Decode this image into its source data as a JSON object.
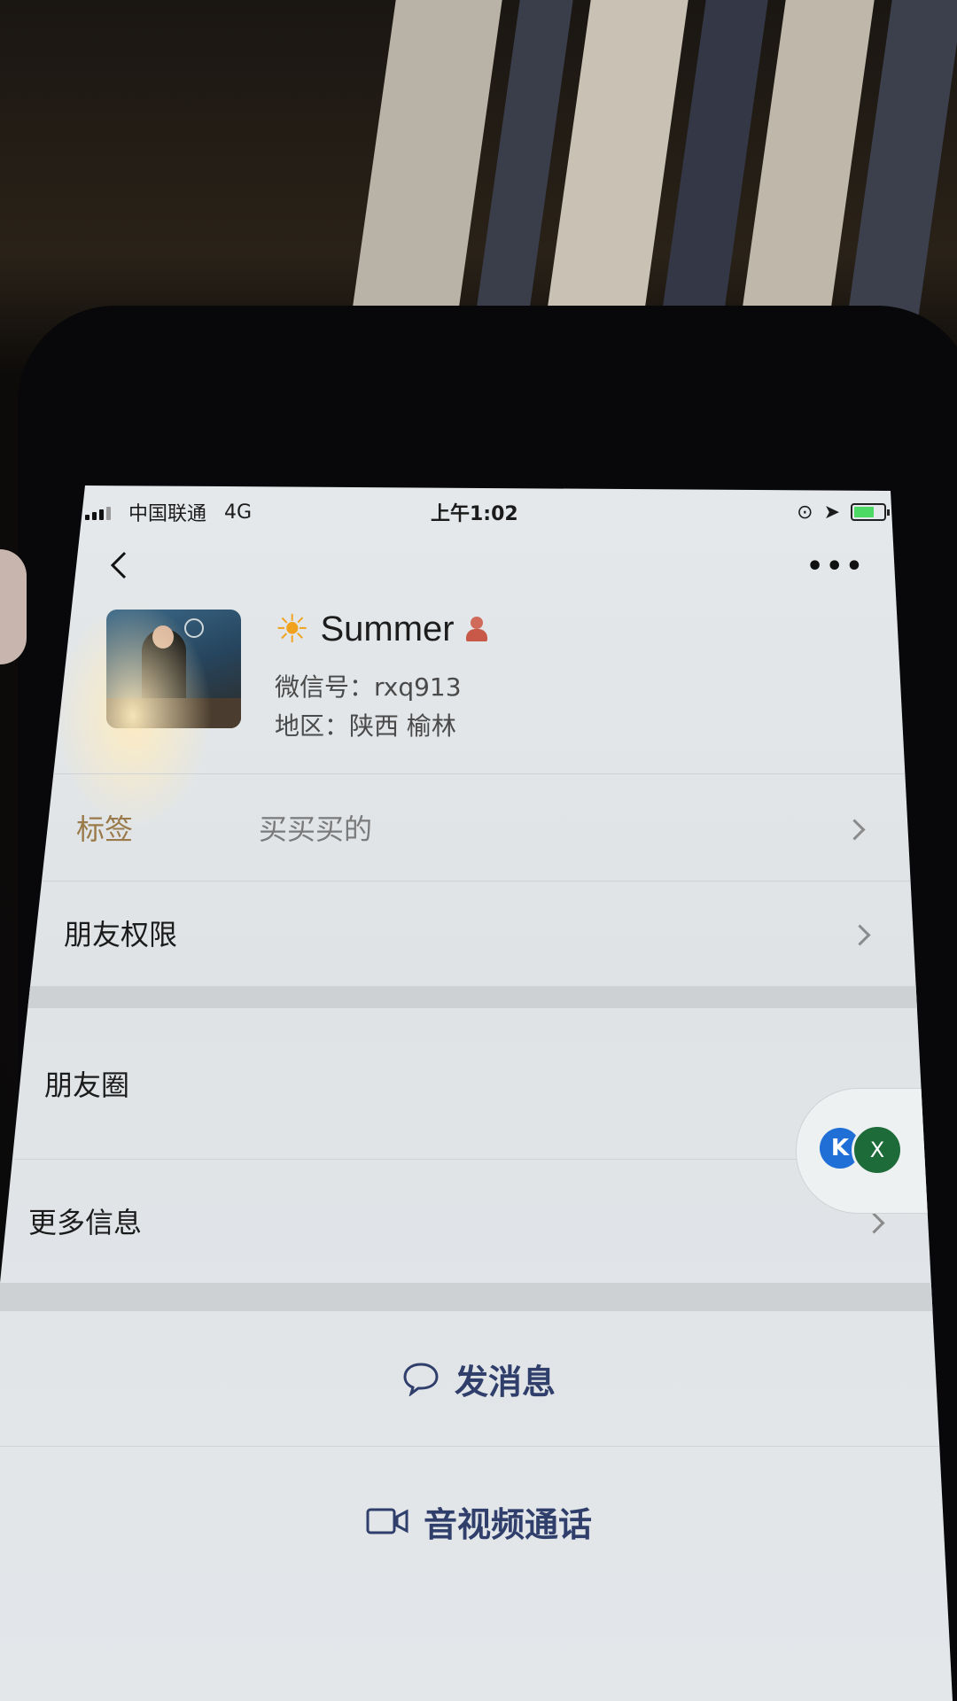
{
  "status_bar": {
    "carrier": "中国联通",
    "network": "4G",
    "time": "上午1:02",
    "battery_level": 0.7,
    "battery_color": "#4cd964"
  },
  "nav": {
    "back_icon": "chevron-left-icon",
    "more_icon": "more-dots-icon",
    "more_label": "•••"
  },
  "profile": {
    "name": "Summer",
    "name_prefix_icon": "sun-icon",
    "sun_glyph": "☀",
    "gender_icon": "female-icon",
    "wechat_id_line": "微信号：rxq913",
    "region_line": "地区：陕西 榆林"
  },
  "rows": {
    "tags": {
      "label": "标签",
      "value": "买买买的",
      "label_color": "#9a7a4a"
    },
    "friend_permissions": {
      "label": "朋友权限"
    },
    "moments": {
      "label": "朋友圈"
    },
    "more_info": {
      "label": "更多信息"
    }
  },
  "actions": {
    "send_message": {
      "label": "发消息",
      "icon": "chat-bubble-icon"
    },
    "video_call": {
      "label": "音视频通话",
      "icon": "video-camera-icon"
    }
  },
  "floating_bubble": {
    "left_badge": "K",
    "right_badge": "X"
  }
}
